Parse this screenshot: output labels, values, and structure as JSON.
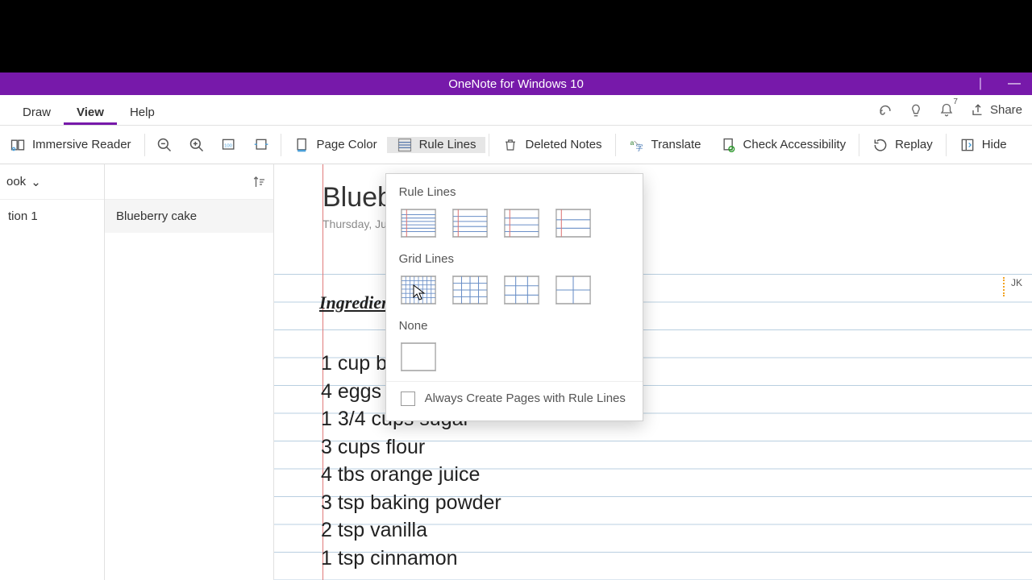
{
  "title_bar": {
    "title": "OneNote for Windows 10",
    "minimize": "—"
  },
  "tabs": {
    "draw": "Draw",
    "view": "View",
    "help": "Help"
  },
  "tabs_right": {
    "notif_badge": "7",
    "share": "Share"
  },
  "ribbon": {
    "immersive": "Immersive Reader",
    "page_color": "Page Color",
    "rule_lines": "Rule Lines",
    "deleted": "Deleted Notes",
    "translate": "Translate",
    "check_access": "Check Accessibility",
    "replay": "Replay",
    "hide": "Hide"
  },
  "nav": {
    "notebook_label": "ook",
    "section": "tion 1",
    "page": "Blueberry cake"
  },
  "page": {
    "title": "Blueberr",
    "date": "Thursday, July 2,",
    "heading": "Ingredients",
    "items": [
      "1 cup but",
      "4 eggs",
      "1 3/4 cups sugar",
      "3 cups flour",
      "4 tbs orange juice",
      "3 tsp baking powder",
      "2 tsp vanilla",
      "1 tsp cinnamon"
    ],
    "author_tag": "JK"
  },
  "dropdown": {
    "rule_lines": "Rule Lines",
    "grid_lines": "Grid Lines",
    "none": "None",
    "always": "Always Create Pages with Rule Lines"
  }
}
